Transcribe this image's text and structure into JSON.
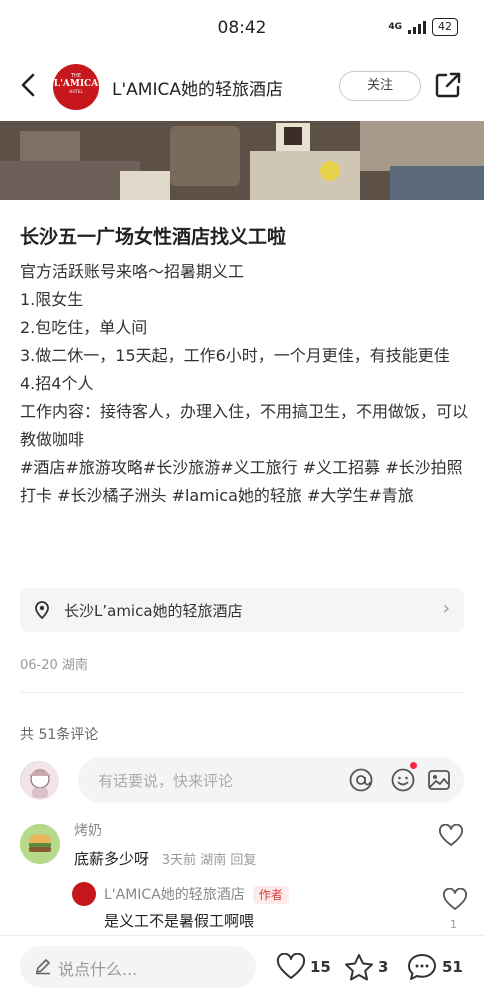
{
  "status_bar": {
    "time": "08:42",
    "network": "4G",
    "battery": "42"
  },
  "header": {
    "back_icon": "chevron-left-icon",
    "logo": {
      "line1": "THE",
      "line2": "L'AMICA",
      "line3": "HOTEL"
    },
    "shop_name": "L'AMICA她的轻旅酒店",
    "follow_label": "关注",
    "share_icon": "share-icon"
  },
  "post": {
    "title": "长沙五一广场女性酒店找义工啦",
    "lines": [
      "官方活跃账号来咯～招暑期义工",
      "1.限女生",
      "2.包吃住，单人间",
      "3.做二休一，15天起，工作6小时，一个月更佳，有技能更佳",
      "4.招4个人",
      "工作内容：接待客人，办理入住，不用搞卫生，不用做饭，可以教做咖啡"
    ],
    "tags": "#酒店#旅游攻略#长沙旅游#义工旅行 #义工招募 #长沙拍照打卡 #长沙橘子洲头 #lamica她的轻旅 #大学生#青旅",
    "location": "长沙L’amica她的轻旅酒店",
    "date": "06-20 湖南"
  },
  "comments": {
    "count_label": "共 51条评论",
    "input_placeholder": "有话要说，快来评论",
    "items": [
      {
        "user": "烤奶",
        "text": "底薪多少呀",
        "meta": "3天前  湖南  回复",
        "reply": {
          "user": "L'AMICA她的轻旅酒店",
          "badge": "作者",
          "text": "是义工不是暑假工啊喂",
          "like_count": "1"
        }
      }
    ]
  },
  "bottom_bar": {
    "say_placeholder": "说点什么...",
    "likes": "15",
    "stars": "3",
    "comments": "51"
  },
  "colors": {
    "brand": "#c8161d",
    "accent": "#ff2442"
  }
}
